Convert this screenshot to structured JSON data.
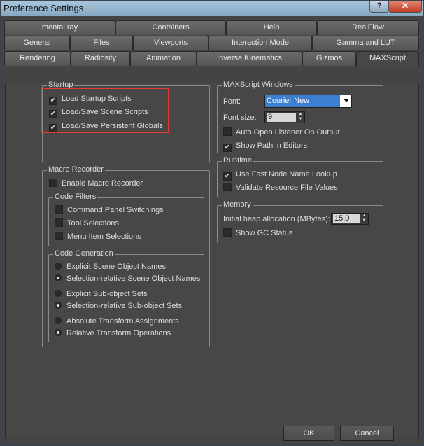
{
  "window": {
    "title": "Preference Settings",
    "help_glyph": "?",
    "close_glyph": "✕"
  },
  "tabs": {
    "row1": [
      "mental ray",
      "Containers",
      "Help",
      "RealFlow"
    ],
    "row2": [
      "General",
      "Files",
      "Viewports",
      "Interaction Mode",
      "Gamma and LUT"
    ],
    "row3": [
      "Rendering",
      "Radiosity",
      "Animation",
      "Inverse Kinematics",
      "Gizmos",
      "MAXScript"
    ],
    "active": "MAXScript"
  },
  "startup": {
    "title": "Startup",
    "items": [
      {
        "label": "Load Startup Scripts",
        "checked": true
      },
      {
        "label": "Load/Save Scene Scripts",
        "checked": true
      },
      {
        "label": "Load/Save Persistent Globals",
        "checked": true
      }
    ]
  },
  "macro_recorder": {
    "title": "Macro Recorder",
    "enable_label": "Enable Macro Recorder",
    "code_filters": {
      "title": "Code Filters",
      "items": [
        "Command Panel Switchings",
        "Tool Selections",
        "Menu Item Selections"
      ]
    },
    "code_generation": {
      "title": "Code Generation",
      "items": [
        {
          "label": "Explicit Scene Object Names",
          "selected": false
        },
        {
          "label": "Selection-relative Scene Object Names",
          "selected": true
        },
        {
          "label": "Explicit Sub-object Sets",
          "selected": false
        },
        {
          "label": "Selection-relative Sub-object Sets",
          "selected": true
        },
        {
          "label": "Absolute Transform Assignments",
          "selected": false
        },
        {
          "label": "Relative Transform Operations",
          "selected": true
        }
      ]
    }
  },
  "maxscript_windows": {
    "title": "MAXScript Windows",
    "font_label": "Font:",
    "font_value": "Courier New",
    "font_size_label": "Font size:",
    "font_size_value": "9",
    "auto_open_label": "Auto Open Listener On Output",
    "auto_open_checked": false,
    "show_path_label": "Show Path in Editors",
    "show_path_checked": true
  },
  "runtime": {
    "title": "Runtime",
    "fast_node_label": "Use Fast Node Name Lookup",
    "fast_node_checked": true,
    "validate_label": "Validate Resource File Values",
    "validate_checked": false
  },
  "memory": {
    "title": "Memory",
    "heap_label": "Initial heap allocation (MBytes):",
    "heap_value": "15.0",
    "gc_label": "Show GC Status",
    "gc_checked": false
  },
  "buttons": {
    "ok": "OK",
    "cancel": "Cancel"
  }
}
